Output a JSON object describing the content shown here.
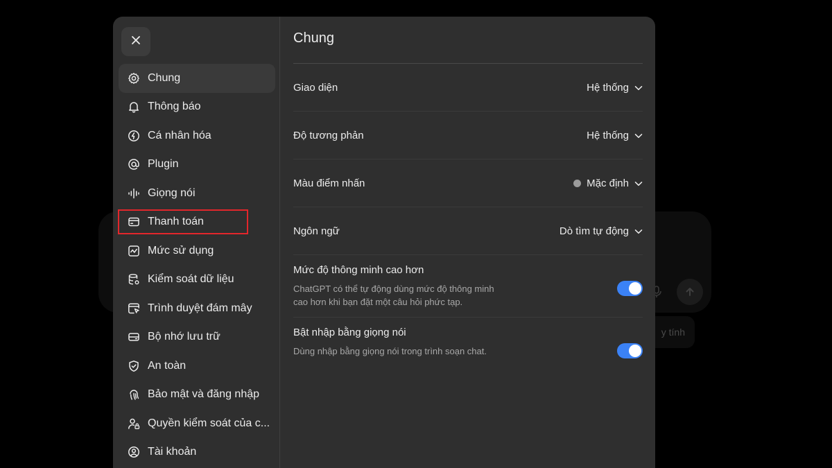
{
  "background": {
    "chip_text": "y tính"
  },
  "sidebar": {
    "close_icon": "close-icon",
    "items": [
      {
        "label": "Chung",
        "icon": "gear-icon",
        "active": true
      },
      {
        "label": "Thông báo",
        "icon": "bell-icon"
      },
      {
        "label": "Cá nhân hóa",
        "icon": "personalize-icon"
      },
      {
        "label": "Plugin",
        "icon": "at-icon"
      },
      {
        "label": "Giọng nói",
        "icon": "waveform-icon"
      },
      {
        "label": "Thanh toán",
        "icon": "card-icon",
        "highlighted": true
      },
      {
        "label": "Mức sử dụng",
        "icon": "chart-icon"
      },
      {
        "label": "Kiểm soát dữ liệu",
        "icon": "database-icon"
      },
      {
        "label": "Trình duyệt đám mây",
        "icon": "cloud-browser-icon"
      },
      {
        "label": "Bộ nhớ lưu trữ",
        "icon": "storage-icon"
      },
      {
        "label": "An toàn",
        "icon": "shield-icon"
      },
      {
        "label": "Bảo mật và đăng nhập",
        "icon": "fingerprint-icon"
      },
      {
        "label": "Quyền kiểm soát của c...",
        "icon": "user-lock-icon"
      },
      {
        "label": "Tài khoản",
        "icon": "account-icon"
      }
    ]
  },
  "content": {
    "title": "Chung",
    "rows": [
      {
        "label": "Giao diện",
        "value": "Hệ thống"
      },
      {
        "label": "Độ tương phản",
        "value": "Hệ thống"
      },
      {
        "label": "Màu điểm nhấn",
        "value": "Mặc định",
        "dot_color": "#9b9b9b"
      },
      {
        "label": "Ngôn ngữ",
        "value": "Dò tìm tự động"
      }
    ],
    "toggles": [
      {
        "title": "Mức độ thông minh cao hơn",
        "desc": "ChatGPT có thể tự động dùng mức độ thông minh cao hơn khi bạn đặt một câu hỏi phức tạp.",
        "on": true
      },
      {
        "title": "Bật nhập bằng giọng nói",
        "desc": "Dùng nhập bằng giọng nói trong trình soạn chat.",
        "on": true
      }
    ]
  },
  "colors": {
    "accent": "#3b82f6",
    "highlight_box": "#e3262b",
    "modal_bg": "#2f2f2f"
  }
}
